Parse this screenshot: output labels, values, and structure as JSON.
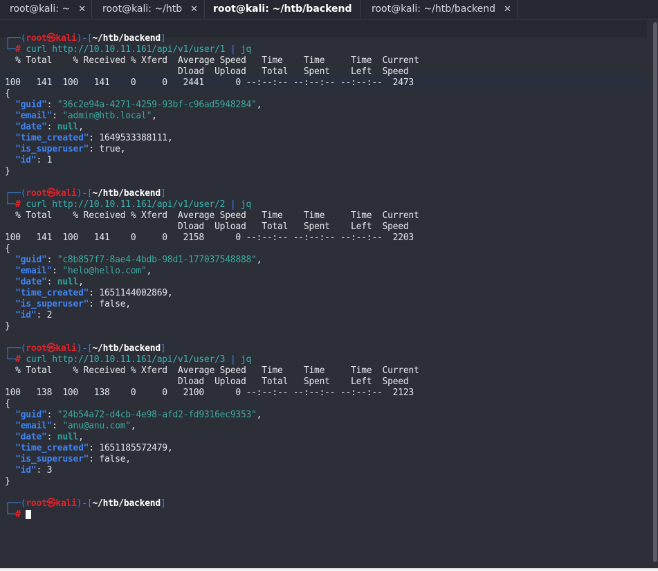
{
  "tabs": [
    {
      "label": "root@kali: ~",
      "active": false
    },
    {
      "label": "root@kali: ~/htb",
      "active": false
    },
    {
      "label": "root@kali: ~/htb/backend",
      "active": true
    },
    {
      "label": "root@kali: ~/htb/backend",
      "active": false
    }
  ],
  "close_glyph": "✕",
  "prompt": {
    "top_left": "┌──(",
    "user": "root㉿kali",
    "mid": ")-[",
    "path": "~/htb/backend",
    "end": "]",
    "bottom_left": "└─",
    "hash": "#"
  },
  "curl_header": {
    "line1": "  % Total    % Received % Xferd  Average Speed   Time    Time     Time  Current",
    "line2": "                                 Dload  Upload   Total   Spent    Left  Speed"
  },
  "blocks": [
    {
      "command": "curl http://10.10.11.161/api/v1/user/1",
      "pipe": "|",
      "pipe_cmd": "jq",
      "progress": "100   141  100   141    0     0   2441      0 --:--:-- --:--:-- --:--:--  2473",
      "json": {
        "guid": "\"36c2e94a-4271-4259-93bf-c96ad5948284\"",
        "email": "\"admin@htb.local\"",
        "date": "null",
        "time_created": "1649533388111",
        "is_superuser": "true",
        "id": "1"
      }
    },
    {
      "command": "curl http://10.10.11.161/api/v1/user/2",
      "pipe": "|",
      "pipe_cmd": "jq",
      "progress": "100   141  100   141    0     0   2158      0 --:--:-- --:--:-- --:--:--  2203",
      "json": {
        "guid": "\"c8b857f7-8ae4-4bdb-98d1-177037548888\"",
        "email": "\"helo@hello.com\"",
        "date": "null",
        "time_created": "1651144002869",
        "is_superuser": "false",
        "id": "2"
      }
    },
    {
      "command": "curl http://10.10.11.161/api/v1/user/3",
      "pipe": "|",
      "pipe_cmd": "jq",
      "progress": "100   138  100   138    0     0   2100      0 --:--:-- --:--:-- --:--:--  2123",
      "json": {
        "guid": "\"24b54a72-d4cb-4e98-afd2-fd9316ec9353\"",
        "email": "\"anu@anu.com\"",
        "date": "null",
        "time_created": "1651185572479",
        "is_superuser": "false",
        "id": "3"
      }
    }
  ],
  "json_keys": {
    "guid": "\"guid\"",
    "email": "\"email\"",
    "date": "\"date\"",
    "time_created": "\"time_created\"",
    "is_superuser": "\"is_superuser\"",
    "id": "\"id\""
  },
  "brace_open": "{",
  "brace_close": "}"
}
